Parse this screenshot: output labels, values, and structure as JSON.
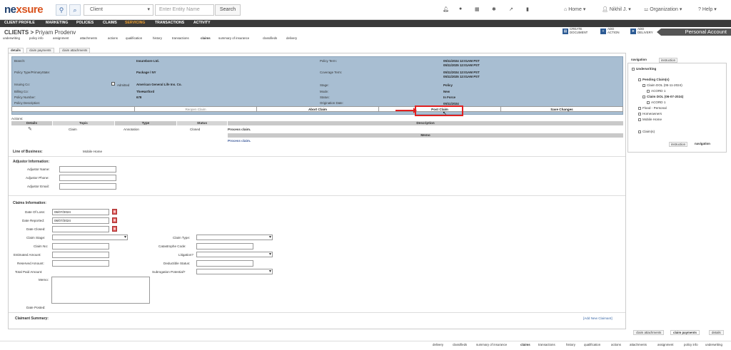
{
  "brand": {
    "name_a": "ne",
    "name_b": "xsure"
  },
  "search": {
    "type_value": "Client",
    "placeholder": "Enter Entity Name",
    "button": "Search"
  },
  "top_menu": {
    "home": "Home",
    "user": "Nikhil J.",
    "org": "Organization",
    "help": "Help"
  },
  "nav": [
    "CLIENT PROFILE",
    "MARKETING",
    "POLICIES",
    "CLAIMS",
    "SERVICING",
    "TRANSACTIONS",
    "ACTIVITY"
  ],
  "nav_active": "SERVICING",
  "breadcrumb": {
    "section": "CLIENTS",
    "sep": ">",
    "name": "Priyam Prodenv"
  },
  "subtabs": [
    "underwriting",
    "policy info",
    "assignment",
    "attachments",
    "actions",
    "qualification",
    "history",
    "transactions",
    "claims",
    "summary of insurance",
    "classifieds",
    "delivery"
  ],
  "subtab_active": "claims",
  "quick_actions": [
    {
      "line1": "CREATE",
      "line2": "DOCUMENT"
    },
    {
      "line1": "ADD",
      "line2": "ACTION"
    },
    {
      "line1": "ADD",
      "line2": "DELIVERY"
    }
  ],
  "account_label": "Personal Account",
  "panel_tabs": [
    "details",
    "claim payments",
    "claim attachments"
  ],
  "info": {
    "branch_label": "Branch:",
    "branch_value": "Insurebore Ltd.",
    "policy_type_label": "Policy Type/PrimaryState:",
    "policy_type_value": "Package / NY",
    "issuing_label": "Issuing Co:",
    "admitted_label": "Admitted",
    "issuing_value": "American General Life Ins. Co.",
    "billing_label": "Billing Co:",
    "billing_value": "TheHartford",
    "policy_num_label": "Policy Number:",
    "policy_num_value": "678",
    "policy_desc_label": "Policy Description:",
    "term_label": "Policy Term:",
    "term_value_1": "05/11/2024  12:01AM PST",
    "term_value_2": "05/11/2025  12:01AM PST",
    "coverage_label": "Coverage Term:",
    "coverage_value_1": "05/11/2024  12:01AM PST",
    "coverage_value_2": "05/11/2025  12:01AM PST",
    "stage_label": "Stage:",
    "stage_value": "Policy",
    "mode_label": "Mode:",
    "mode_value": "New",
    "status_label": "Status:",
    "status_value": "In Force",
    "orig_label": "Origination Date:",
    "orig_value": "05/11/2024"
  },
  "claim_buttons": {
    "reopen": "Reopen Claim",
    "abort": "Abort Claim",
    "post": "Post Claim",
    "save": "Save Changes"
  },
  "actions": {
    "label": "Actions:",
    "headers": [
      "Details",
      "Topic",
      "Type",
      "Status",
      "Description"
    ],
    "row": {
      "topic": "Claim",
      "type": "Annotation",
      "status": "Closed",
      "description": "Process claim."
    },
    "memo_header": "Memo",
    "memo_value": "Process claim."
  },
  "line_of_business": {
    "label": "Line of Business:",
    "value": "Mobile Home"
  },
  "adjustor": {
    "title": "Adjustor Information:",
    "name_label": "Adjustor Name:",
    "phone_label": "Adjustor Phone:",
    "email_label": "Adjustor Email:"
  },
  "claims": {
    "title": "Claims Information:",
    "date_loss_label": "Date Of Loss:",
    "date_loss_value": "06/07/2024",
    "date_reported_label": "Date Reported:",
    "date_reported_value": "06/07/2024",
    "date_closed_label": "Date Closed:",
    "claim_stage_label": "Claim Stage:",
    "claim_no_label": "Claim No:",
    "estimated_label": "Estimated Amount:",
    "reserved_label": "Reserved Amount:",
    "total_paid_label": "Total Paid Amount:",
    "memo_label": "Memo:",
    "date_posted_label": "Date Posted:",
    "claim_type_label": "Claim Type:",
    "catastrophe_label": "Catastrophe Code:",
    "litigation_label": "Litigation?",
    "deductible_label": "Deductible Status:",
    "subrogation_label": "Subrogation Potential?"
  },
  "claimant": {
    "title": "Claimant Summary:",
    "add_link": "[Add New Claimant]"
  },
  "side": {
    "tabs": [
      "navigation",
      "instruction"
    ],
    "tree": [
      "Underwriting",
      "Pending Claim(s)",
      "Claim DOL (05-11-2024)",
      "ACORD 1",
      "Claim DOL (06-07-2024)",
      "ACORD 1",
      "Flood - Personal",
      "Homeowners",
      "Mobile Home",
      "Claim(s)"
    ],
    "bottom_tabs": [
      "instruction",
      "navigation"
    ]
  },
  "bottom_tabs": [
    "claim attachments",
    "claim payments",
    "details"
  ],
  "footer_tabs": [
    "delivery",
    "classifieds",
    "summary of insurance",
    "claims",
    "transactions",
    "history",
    "qualification",
    "actions",
    "attachments",
    "assignment",
    "policy info",
    "underwriting"
  ],
  "footer_active": "claims"
}
